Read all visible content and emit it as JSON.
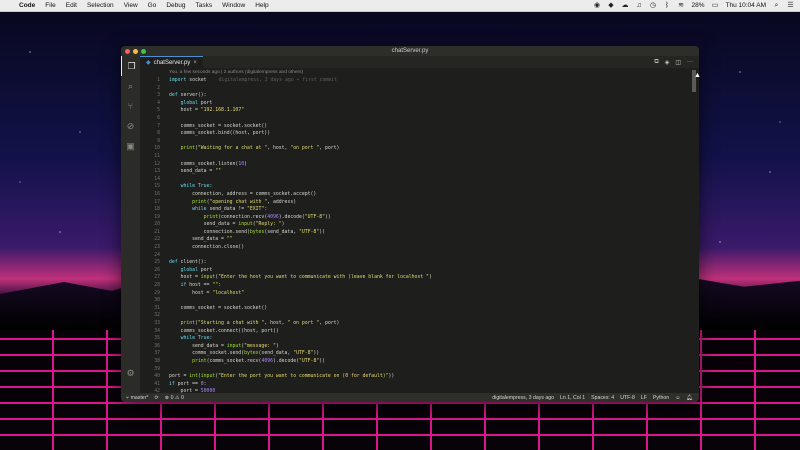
{
  "menubar": {
    "app_name": "Code",
    "items": [
      "File",
      "Edit",
      "Selection",
      "View",
      "Go",
      "Debug",
      "Tasks",
      "Window",
      "Help"
    ],
    "battery": "28%",
    "clock": "Thu 10:04 AM"
  },
  "window": {
    "title": "chatServer.py",
    "traffic_lights": [
      "#fc605c",
      "#fdbc40",
      "#34c84a"
    ]
  },
  "activitybar": {
    "icons": [
      "files-icon",
      "search-icon",
      "source-control-icon",
      "debug-icon",
      "extensions-icon"
    ],
    "bottom_icon": "gear-icon"
  },
  "tabs": [
    {
      "label": "chatServer.py",
      "close": "×"
    }
  ],
  "editor_actions": [
    "split-editor-icon",
    "open-changes-icon",
    "compare-icon",
    "more-icon"
  ],
  "codelens": "You, a few seconds ago | 2 authors (digitalempress and others)",
  "lines": [
    {
      "n": "1",
      "t": "import socket",
      "blame": "digitalempress, 3 days ago • first commit"
    },
    {
      "n": "2",
      "t": ""
    },
    {
      "n": "3",
      "t": "def server():"
    },
    {
      "n": "4",
      "t": "    global port"
    },
    {
      "n": "5",
      "t": "    host = \"192.168.1.107\""
    },
    {
      "n": "6",
      "t": ""
    },
    {
      "n": "7",
      "t": "    comms_socket = socket.socket()"
    },
    {
      "n": "8",
      "t": "    comms_socket.bind((host, port))"
    },
    {
      "n": "9",
      "t": ""
    },
    {
      "n": "10",
      "t": "    print(\"Waiting for a chat at \", host, \"on port \", port)"
    },
    {
      "n": "11",
      "t": ""
    },
    {
      "n": "12",
      "t": "    comms_socket.listen(10)"
    },
    {
      "n": "13",
      "t": "    send_data = \"\""
    },
    {
      "n": "14",
      "t": ""
    },
    {
      "n": "15",
      "t": "    while True:"
    },
    {
      "n": "16",
      "t": "        connection, address = comms_socket.accept()"
    },
    {
      "n": "17",
      "t": "        print(\"opening chat with \", address)"
    },
    {
      "n": "18",
      "t": "        while send_data != \"EXIT\":"
    },
    {
      "n": "19",
      "t": "            print(connection.recv(4096).decode(\"UTF-8\"))"
    },
    {
      "n": "20",
      "t": "            send_data = input(\"Reply: \")"
    },
    {
      "n": "21",
      "t": "            connection.send(bytes(send_data, \"UTF-8\"))"
    },
    {
      "n": "22",
      "t": "        send_data = \"\""
    },
    {
      "n": "23",
      "t": "        connection.close()"
    },
    {
      "n": "24",
      "t": ""
    },
    {
      "n": "25",
      "t": "def client():"
    },
    {
      "n": "26",
      "t": "    global port"
    },
    {
      "n": "27",
      "t": "    host = input(\"Enter the host you want to communicate with (leave blank for localhost \")"
    },
    {
      "n": "28",
      "t": "    if host == \"\":"
    },
    {
      "n": "29",
      "t": "        host = \"localhost\""
    },
    {
      "n": "30",
      "t": ""
    },
    {
      "n": "31",
      "t": "    comms_socket = socket.socket()"
    },
    {
      "n": "32",
      "t": ""
    },
    {
      "n": "33",
      "t": "    print(\"Starting a chat with \", host, \" on port \", port)"
    },
    {
      "n": "34",
      "t": "    comms_socket.connect((host, port))"
    },
    {
      "n": "35",
      "t": "    while True:"
    },
    {
      "n": "36",
      "t": "        send_data = input(\"message: \")"
    },
    {
      "n": "37",
      "t": "        comms_socket.send(bytes(send_data, \"UTF-8\"))"
    },
    {
      "n": "38",
      "t": "        print(comms_socket.recv(4096).decode(\"UTF-8\"))"
    },
    {
      "n": "39",
      "t": ""
    },
    {
      "n": "40",
      "t": "port = int(input(\"Enter the port you want to communicate on (0 for default)\"))"
    },
    {
      "n": "41",
      "t": "if port == 0:"
    },
    {
      "n": "42",
      "t": "    port = 50000"
    }
  ],
  "statusbar": {
    "branch": "master*",
    "sync": "⟳",
    "problems": "⊗ 0 ⚠ 0",
    "blame": "digitalempress, 3 days ago",
    "position": "Ln 1, Col 1",
    "spaces": "Spaces: 4",
    "encoding": "UTF-8",
    "eol": "LF",
    "language": "Python"
  }
}
